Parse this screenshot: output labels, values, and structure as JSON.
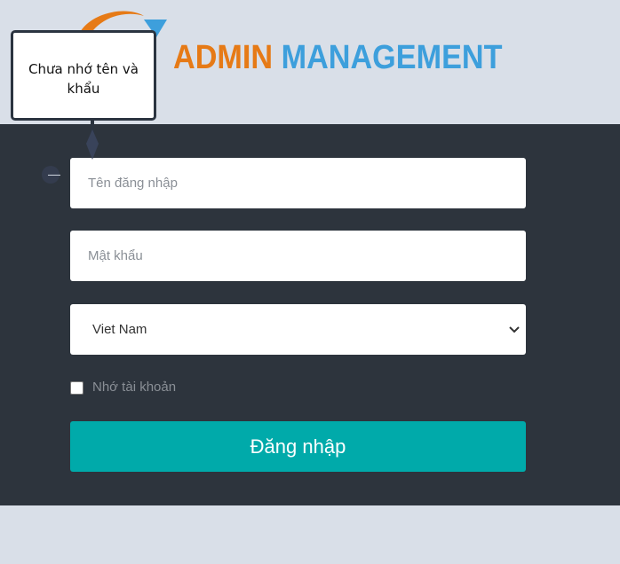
{
  "logo": {
    "word1": "ADMIN",
    "word2": "MANAGEMENT"
  },
  "tooltip": {
    "text": "Chưa nhớ tên và khẩu"
  },
  "form": {
    "username_placeholder": "Tên đăng nhập",
    "password_placeholder": "Mật khẩu",
    "country_value": "Viet Nam",
    "remember_label": "Nhớ tài khoản",
    "remember_checked": false,
    "login_label": "Đăng nhập"
  },
  "colors": {
    "background": "#d9dfe8",
    "panel": "#2d343d",
    "logo_admin": "#e67a16",
    "logo_management": "#3d9fdc",
    "login_button": "#00aaaa"
  }
}
